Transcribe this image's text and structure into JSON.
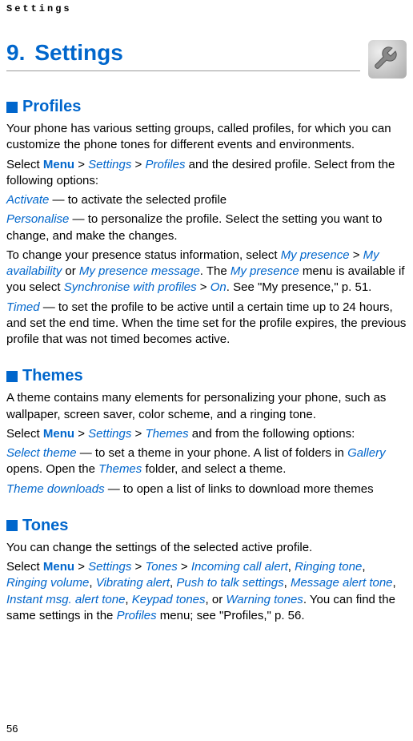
{
  "header": "Settings",
  "chapter": {
    "number": "9.",
    "title": "Settings"
  },
  "sections": {
    "profiles": {
      "heading": "Profiles",
      "p1": "Your phone has various setting groups, called profiles, for which you can customize the phone tones for different events and environments.",
      "p2_pre": "Select ",
      "menu": "Menu",
      "gt": " > ",
      "settings": "Settings",
      "profiles_link": "Profiles",
      "p2_post": " and the desired profile. Select from the following options:",
      "activate": "Activate",
      "activate_desc": " — to activate the selected profile",
      "personalise": "Personalise",
      "personalise_desc": " — to personalize the profile. Select the setting you want to change, and make the changes.",
      "presence_pre": "To change your presence status information, select ",
      "my_presence": "My presence",
      "my_availability": "My availability",
      "or": " or ",
      "my_presence_message": "My presence message",
      "presence_mid": ". The ",
      "presence_mid2": " menu is available if you select ",
      "sync": "Synchronise with profiles",
      "on": "On",
      "presence_post": ". See \"My presence,\" p. 51.",
      "timed": "Timed",
      "timed_desc": " — to set the profile to be active until a certain time up to 24 hours, and set the end time. When the time set for the profile expires, the previous profile that was not timed becomes active."
    },
    "themes": {
      "heading": "Themes",
      "p1": "A theme contains many elements for personalizing your phone, such as wallpaper, screen saver, color scheme, and a ringing tone.",
      "p2_pre": "Select ",
      "themes_link": "Themes",
      "p2_post": " and from the following options:",
      "select_theme": "Select theme",
      "select_theme_desc_pre": " — to set a theme in your phone. A list of folders in ",
      "gallery": "Gallery",
      "select_theme_desc_mid": " opens. Open the ",
      "themes_folder": "Themes",
      "select_theme_desc_post": " folder, and select a theme.",
      "theme_downloads": "Theme downloads",
      "theme_downloads_desc": " — to open a list of links to download more themes"
    },
    "tones": {
      "heading": "Tones",
      "p1": "You can change the settings of the selected active profile.",
      "p2_pre": "Select ",
      "tones_link": "Tones",
      "sep": "  > ",
      "incoming": "Incoming call alert",
      "comma": ", ",
      "ringing_tone": "Ringing tone",
      "ringing_volume": "Ringing volume",
      "vibrating": "Vibrating alert",
      "push": "Push to talk settings",
      "message_alert": "Message alert tone",
      "instant": "Instant msg. alert tone",
      "keypad": "Keypad tones",
      "or_text": ", or ",
      "warning": "Warning tones",
      "p2_post_pre": ". You can find the same settings in the ",
      "profiles_menu": "Profiles",
      "p2_post": " menu; see \"Profiles,\" p. 56."
    }
  },
  "page_number": "56"
}
